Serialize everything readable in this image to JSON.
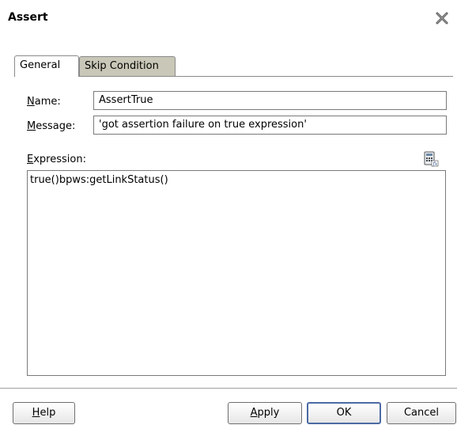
{
  "dialog": {
    "title": "Assert",
    "close_icon": "close-x-icon"
  },
  "tabs": [
    {
      "label": "General",
      "active": true
    },
    {
      "label": "Skip Condition",
      "active": false
    }
  ],
  "form": {
    "name_label_mnemonic": "N",
    "name_label_rest": "ame:",
    "name_value": "AssertTrue",
    "message_label_mnemonic": "M",
    "message_label_rest": "essage:",
    "message_value": "'got assertion failure on true expression'",
    "expression_label_mnemonic": "E",
    "expression_label_rest": "xpression:",
    "expression_value": "true()bpws:getLinkStatus()",
    "expression_builder_icon": "expression-builder-icon"
  },
  "footer": {
    "help_mnemonic": "H",
    "help_rest": "elp",
    "apply_mnemonic": "A",
    "apply_rest": "pply",
    "ok_label": "OK",
    "cancel_label": "Cancel"
  },
  "colors": {
    "inactive_tab": "#c9c7b7",
    "default_button_border": "#4b6aa3"
  }
}
